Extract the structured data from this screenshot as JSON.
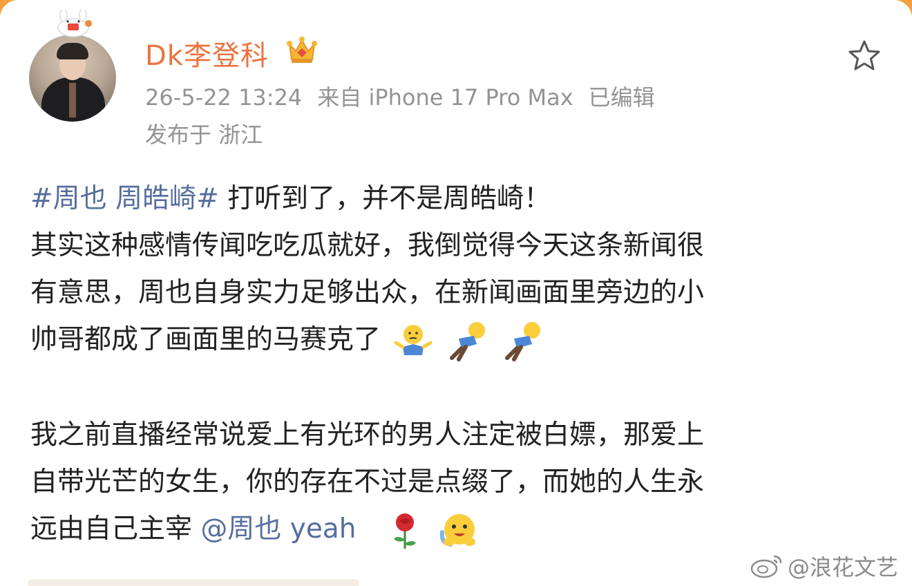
{
  "post": {
    "author": "Dk李登科",
    "timestamp": "26-5-22 13:24",
    "source": "来自 iPhone 17 Pro Max",
    "edited": "已编辑",
    "location": "发布于 浙江",
    "line1_topic": "#周也 周皓崎#",
    "line1_text": " 打听到了，并不是周皓崎！",
    "line2": "其实这种感情传闻吃吃瓜就好，我倒觉得今天这条新闻很",
    "line3": "有意思，周也自身实力足够出众，在新闻画面里旁边的小",
    "line4": "帅哥都成了画面里的马赛克了",
    "line5": "我之前直播经常说爱上有光环的男人注定被白嫖，那爱上",
    "line6": "自带光芒的女生，你的存在不过是点缀了，而她的人生永",
    "line7_text": "远由自己主宰 ",
    "line7_mention": "@周也 yeah",
    "emojis": [
      "shrug-emoji",
      "lying-down-emoji",
      "lying-down-emoji",
      "rose-emoji",
      "hug-emoji"
    ]
  },
  "watermark": {
    "label": "@浪花文艺",
    "logo": "weibo-logo-icon"
  },
  "colors": {
    "accent": "#eb7340",
    "link": "#566e9f",
    "meta": "#939393",
    "text": "#222222",
    "background": "#f4a03a"
  }
}
